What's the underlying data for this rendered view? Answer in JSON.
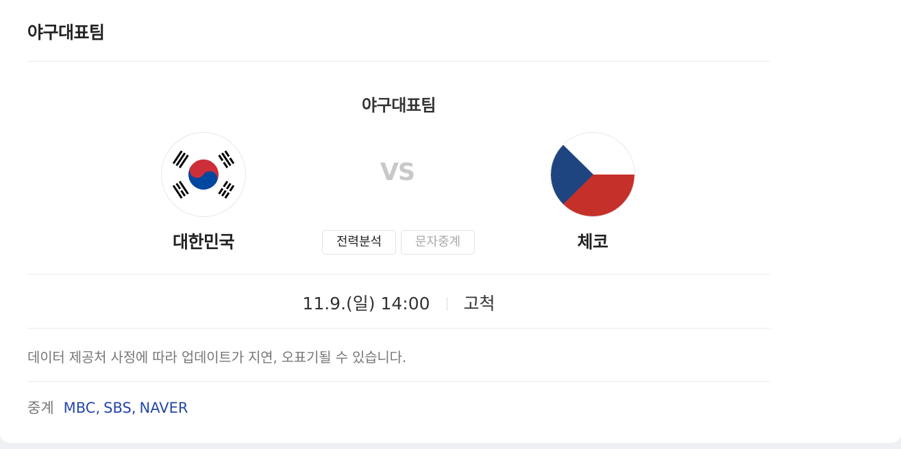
{
  "card": {
    "title": "야구대표팀"
  },
  "match": {
    "title": "야구대표팀",
    "vs_label": "VS",
    "home_team": {
      "name": "대한민국",
      "logo": "south-korea-flag-icon"
    },
    "away_team": {
      "name": "체코",
      "logo": "czech-flag-icon"
    },
    "buttons": {
      "analysis": "전력분석",
      "text_relay": "문자중계"
    },
    "date_time": "11.9.(일) 14:00",
    "venue": "고척"
  },
  "notice": "데이터 제공처 사정에 따라 업데이트가 지연, 오표기될 수 있습니다.",
  "broadcast": {
    "label": "중계",
    "channels": [
      "MBC",
      "SBS",
      "NAVER"
    ],
    "separator": ","
  },
  "colors": {
    "link": "#2446a8",
    "korea_red": "#cd2e3a",
    "korea_blue": "#0047a0",
    "czech_red": "#c6302a",
    "czech_blue": "#1f4580",
    "vs_gray": "#c8c8c8"
  }
}
